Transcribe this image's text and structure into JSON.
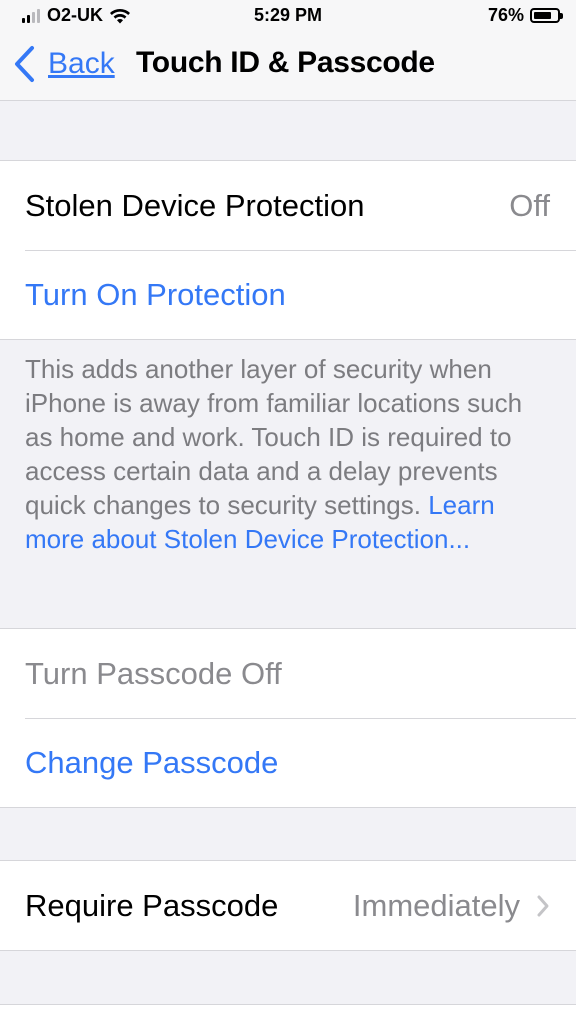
{
  "status_bar": {
    "carrier": "O2-UK",
    "time": "5:29 PM",
    "battery_percent_label": "76%",
    "battery_level": 0.76
  },
  "nav": {
    "back_label": "Back",
    "title": "Touch ID & Passcode"
  },
  "protection_group": {
    "stolen_device_label": "Stolen Device Protection",
    "stolen_device_value": "Off",
    "turn_on_label": "Turn On Protection"
  },
  "protection_footer": {
    "text": "This adds another layer of security when iPhone is away from familiar locations such as home and work. Touch ID is required to access certain data and a delay prevents quick changes to security settings. ",
    "link": "Learn more about Stolen Device Protection..."
  },
  "passcode_group": {
    "turn_off_label": "Turn Passcode Off",
    "change_label": "Change Passcode"
  },
  "require_group": {
    "require_label": "Require Passcode",
    "require_value": "Immediately"
  },
  "colors": {
    "accent": "#3478f6",
    "secondary_text": "#8a8a8e",
    "background": "#f2f2f6"
  },
  "icons": {
    "back": "chevron-left-icon",
    "disclosure": "chevron-right-icon",
    "wifi": "wifi-icon",
    "signal": "cellular-signal-icon",
    "battery": "battery-icon"
  }
}
